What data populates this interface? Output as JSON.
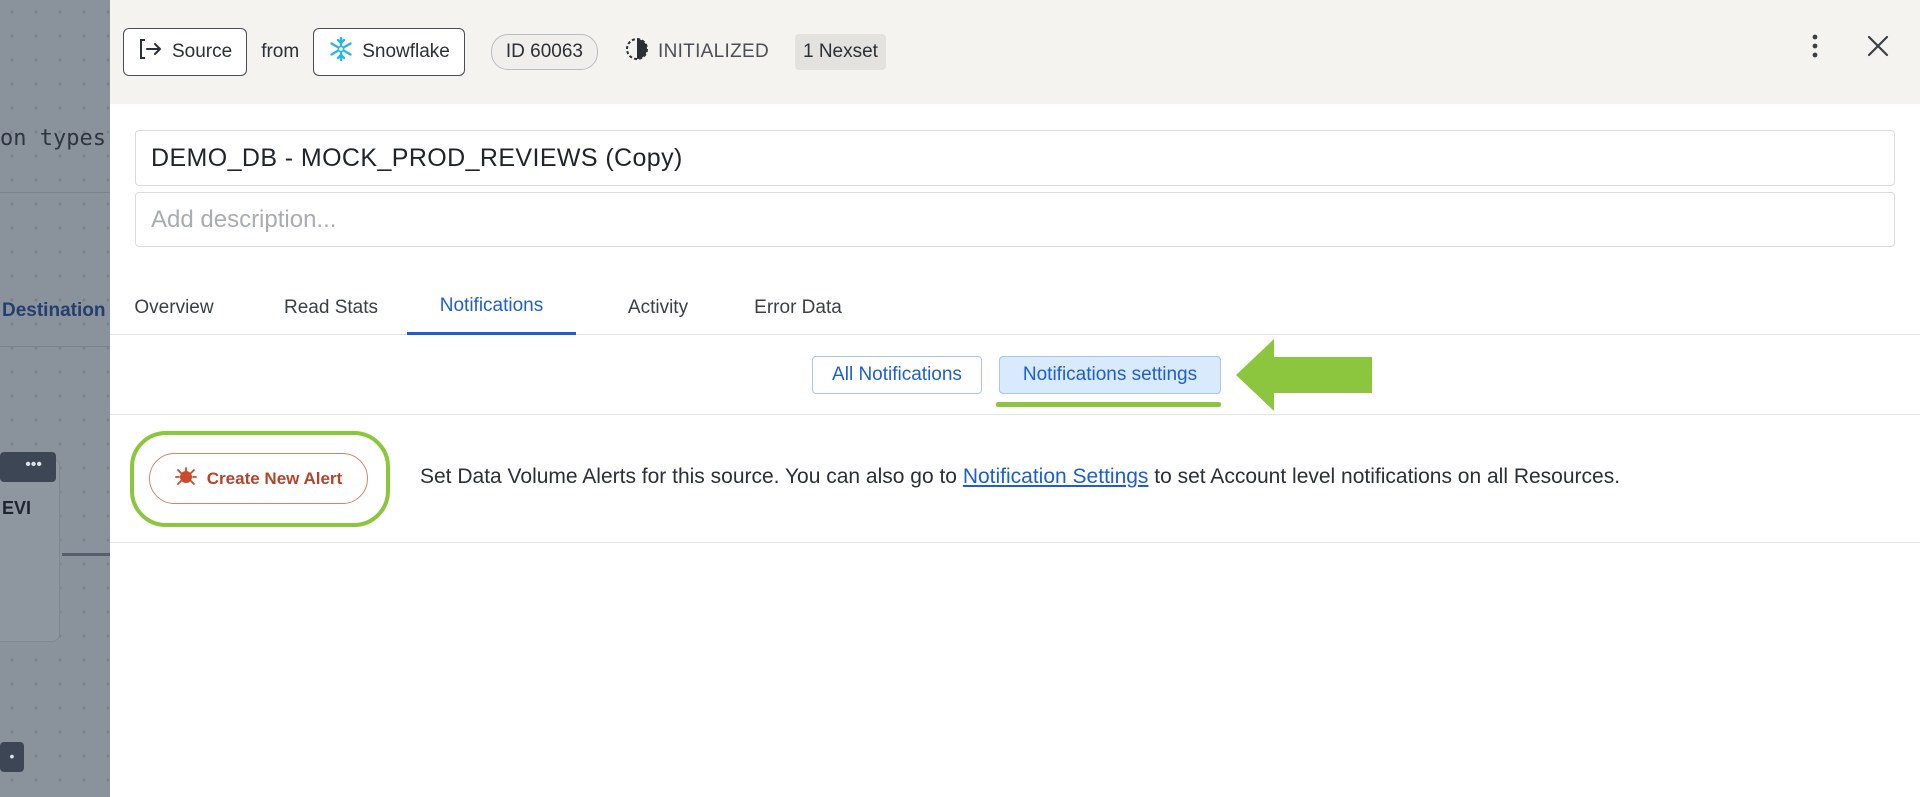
{
  "background": {
    "types_text": "on types",
    "destination_text": "Destination",
    "card_text": "EVI",
    "chip_text": "•••",
    "chip2_text": "•"
  },
  "header": {
    "source_label": "Source",
    "from_label": "from",
    "connector_label": "Snowflake",
    "id_label": "ID 60063",
    "status_label": "INITIALIZED",
    "nexset_label": "1 Nexset",
    "more_icon": "vertical-dots-icon",
    "close_icon": "close-icon"
  },
  "title": {
    "value": "DEMO_DB - MOCK_PROD_REVIEWS (Copy)",
    "description_placeholder": "Add description..."
  },
  "tabs": [
    {
      "label": "Overview",
      "active": false
    },
    {
      "label": "Read Stats",
      "active": false
    },
    {
      "label": "Notifications",
      "active": true
    },
    {
      "label": "Activity",
      "active": false
    },
    {
      "label": "Error Data",
      "active": false
    }
  ],
  "subtabs": [
    {
      "label": "All Notifications",
      "selected": false
    },
    {
      "label": "Notifications settings",
      "selected": true
    }
  ],
  "alerts": {
    "create_button_label": "Create New Alert",
    "text_before_link": "Set Data Volume Alerts for this source. You can also go to ",
    "link_label": "Notification Settings",
    "text_after_link": " to set Account level notifications on all Resources."
  },
  "colors": {
    "accent": "#1e5fd0",
    "highlight": "#8cc63f",
    "alert_red": "#b8432b",
    "snowflake_blue": "#29b5e8"
  }
}
